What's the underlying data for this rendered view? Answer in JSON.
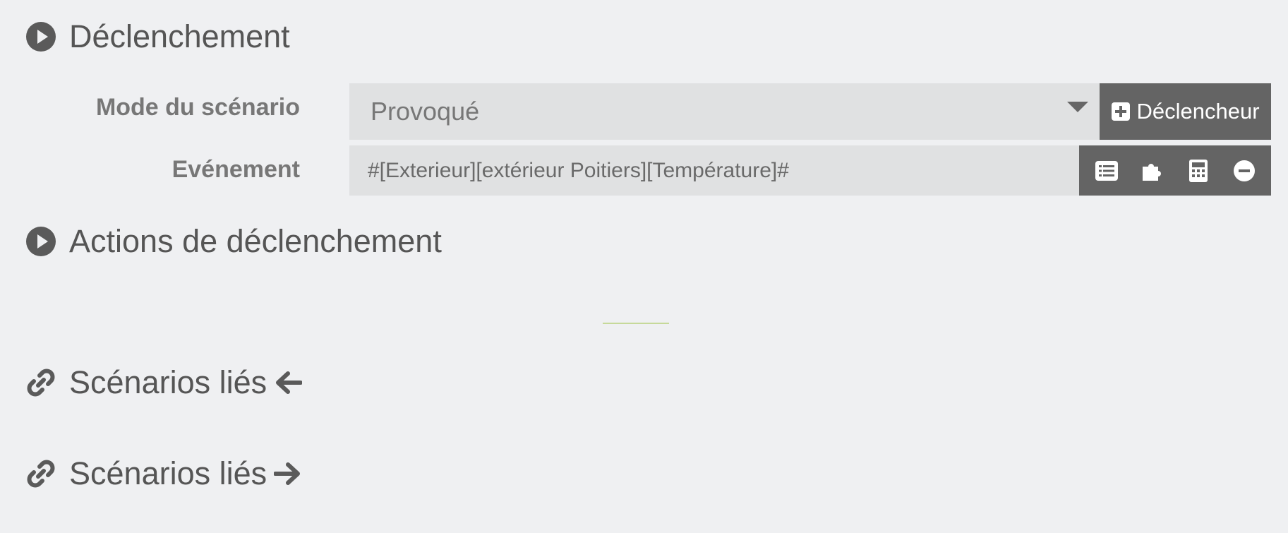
{
  "sections": {
    "trigger": {
      "title": "Déclenchement",
      "icon": "play-circle-icon"
    },
    "trigger_actions": {
      "title": "Actions de déclenchement",
      "icon": "play-circle-icon"
    },
    "linked_in": {
      "title": "Scénarios liés",
      "icon": "link-icon",
      "arrow": "arrow-left-icon"
    },
    "linked_out": {
      "title": "Scénarios liés",
      "icon": "link-icon",
      "arrow": "arrow-right-icon"
    }
  },
  "form": {
    "mode": {
      "label": "Mode du scénario",
      "value": "Provoqué"
    },
    "add_trigger_button": "Déclencheur",
    "event": {
      "label": "Evénement",
      "value": "#[Exterieur][extérieur Poitiers][Température]#"
    },
    "event_actions": [
      "list-icon",
      "puzzle-icon",
      "calculator-icon",
      "minus-circle-icon"
    ]
  },
  "colors": {
    "background": "#eff0f2",
    "input_background": "#e0e1e2",
    "button_background": "#646464",
    "divider": "#c6d99a",
    "text": "#555555"
  }
}
